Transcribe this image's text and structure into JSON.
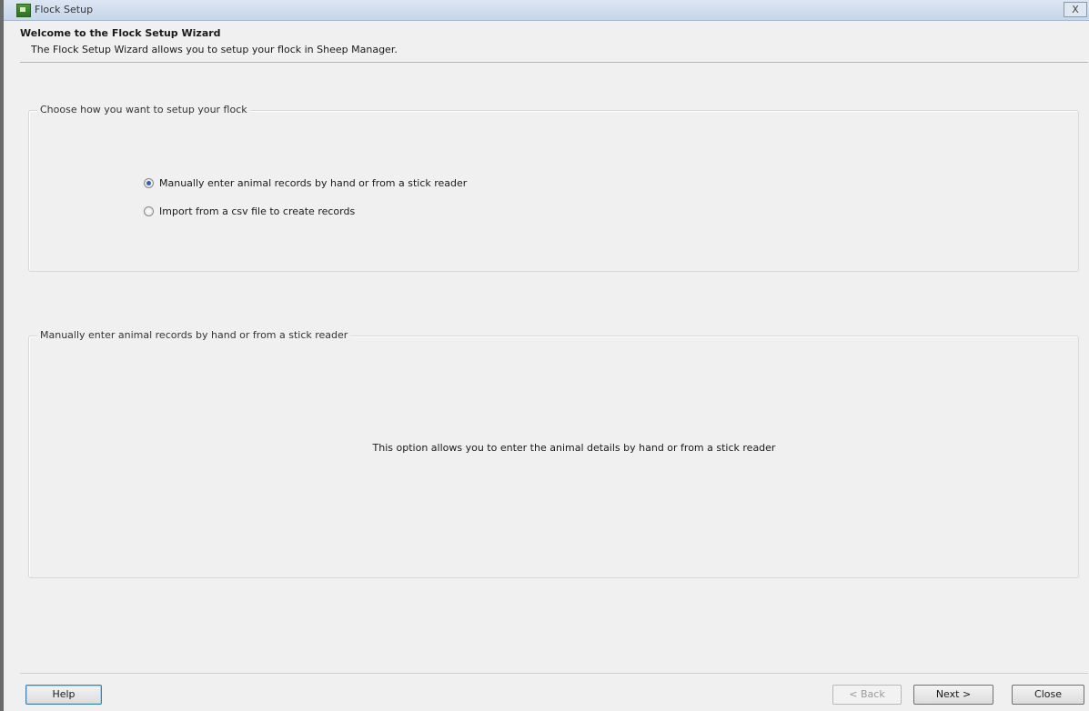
{
  "window": {
    "title": "Flock Setup",
    "close_label": "X"
  },
  "header": {
    "welcome": "Welcome to the Flock Setup Wizard",
    "subtitle": "The Flock Setup Wizard allows you to setup your flock in Sheep Manager."
  },
  "setup_choice": {
    "legend": "Choose how you want to setup your flock",
    "options": [
      {
        "label": "Manually enter animal records by hand or from a stick reader",
        "checked": true
      },
      {
        "label": "Import from a csv file to create records",
        "checked": false
      }
    ]
  },
  "details": {
    "legend": "Manually enter animal records by hand or from a stick reader",
    "description": "This option allows you to enter the animal details by hand or from a stick reader"
  },
  "buttons": {
    "help": "Help",
    "back": "< Back",
    "next": "Next >",
    "close": "Close"
  }
}
